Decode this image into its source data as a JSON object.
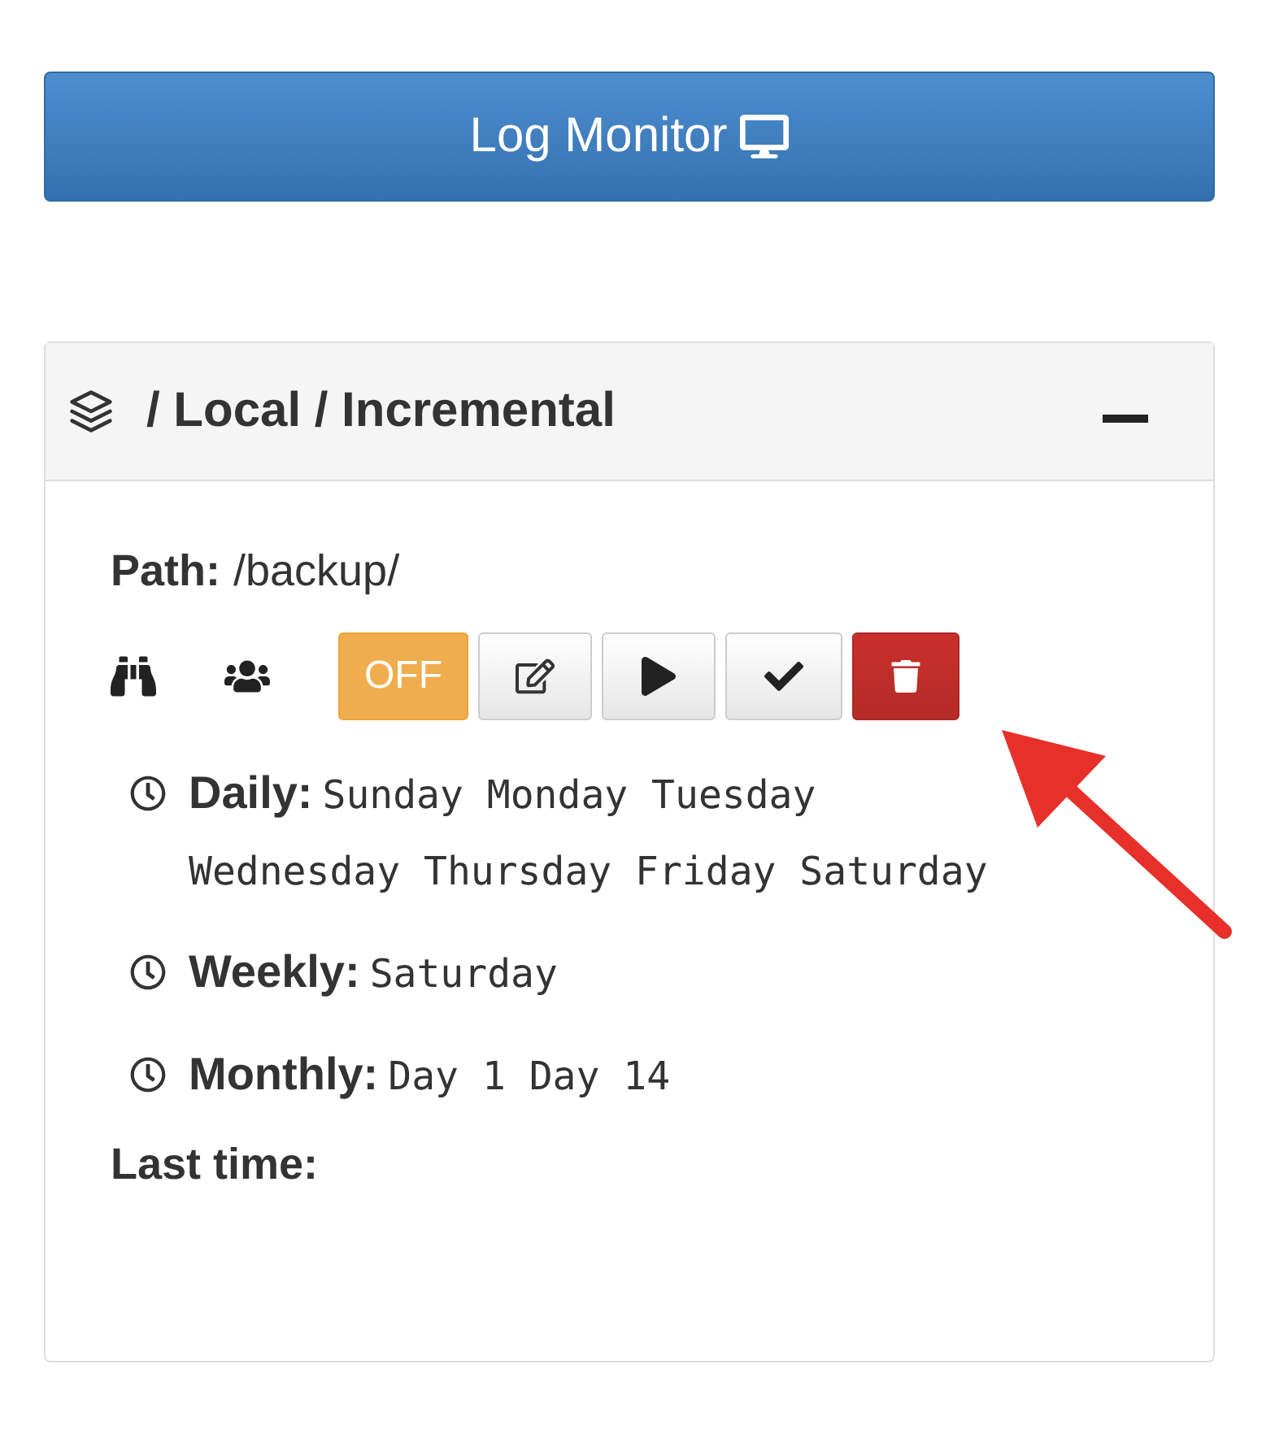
{
  "log_button": {
    "label": "Log Monitor"
  },
  "panel": {
    "title": "/ Local / Incremental",
    "expanded": true,
    "path": {
      "label": "Path:",
      "value": "/backup/"
    },
    "toggle": {
      "label": "OFF",
      "on": false
    },
    "schedules": [
      {
        "label": "Daily:",
        "value": "Sunday Monday Tuesday Wednesday Thursday Friday Saturday"
      },
      {
        "label": "Weekly:",
        "value": "Saturday"
      },
      {
        "label": "Monthly:",
        "value": "Day 1 Day 14"
      }
    ],
    "last_time": {
      "label": "Last time:"
    }
  }
}
